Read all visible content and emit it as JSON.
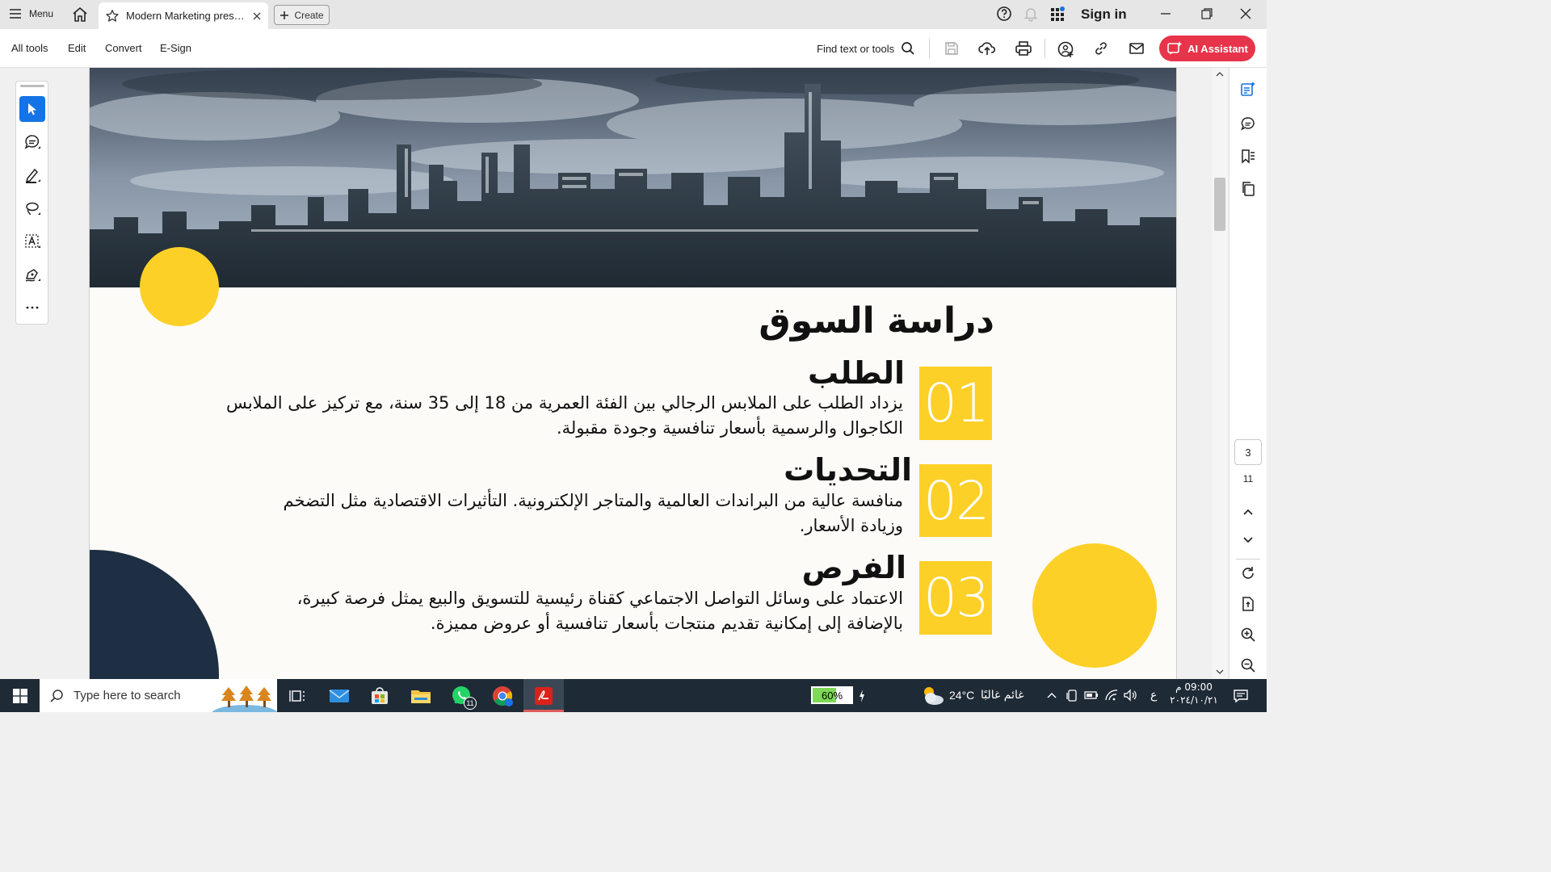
{
  "titlebar": {
    "menu_label": "Menu",
    "tab_title": "Modern Marketing prese...",
    "create_label": "Create",
    "sign_in_label": "Sign in"
  },
  "toolbar": {
    "menu_items": [
      "All tools",
      "Edit",
      "Convert",
      "E-Sign"
    ],
    "find_label": "Find text or tools",
    "ai_assistant_label": "AI Assistant"
  },
  "slide": {
    "title": "دراسة السوق",
    "sections": [
      {
        "number": "01",
        "heading": "الطلب",
        "body_line1": "يزداد الطلب على الملابس الرجالي بين الفئة العمرية من 18 إلى 35 سنة، مع تركيز على الملابس",
        "body_line2": "الكاجوال والرسمية بأسعار تنافسية وجودة مقبولة."
      },
      {
        "number": "02",
        "heading": "التحديات",
        "body_line1": "منافسة عالية من البراندات العالمية والمتاجر الإلكترونية. التأثيرات الاقتصادية مثل التضخم",
        "body_line2": "وزيادة الأسعار."
      },
      {
        "number": "03",
        "heading": "الفرص",
        "body_line1": "الاعتماد على وسائل التواصل الاجتماعي كقناة رئيسية للتسويق والبيع يمثل فرصة كبيرة،",
        "body_line2": "بالإضافة إلى إمكانية تقديم منتجات بأسعار تنافسية أو عروض مميزة."
      }
    ]
  },
  "page_nav": {
    "current_page": "3",
    "total_pages": "11"
  },
  "taskbar": {
    "search_placeholder": "Type here to search",
    "whatsapp_badge": "11",
    "battery_percent": "60%",
    "battery_level": 0.6,
    "temperature": "24°C",
    "weather": "غائم غالبًا",
    "language": "ع",
    "time": "09:00 م",
    "date": "٢٠٢٤/١٠/٢١"
  },
  "colors": {
    "accent_yellow": "#fdd027",
    "navy": "#1e2f44",
    "ai_red": "#e8344a",
    "active_blue": "#1473e6"
  }
}
